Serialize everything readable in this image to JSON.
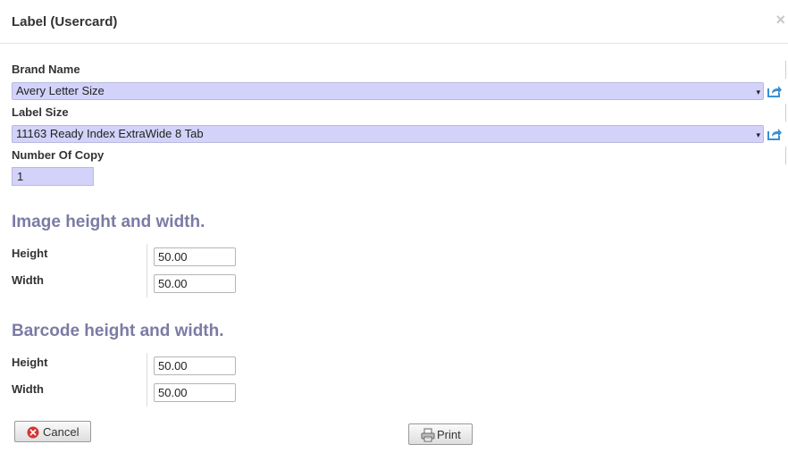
{
  "dialog": {
    "title": "Label (Usercard)",
    "close_symbol": "×"
  },
  "form": {
    "brand": {
      "label": "Brand Name",
      "value": "Avery Letter Size"
    },
    "size": {
      "label": "Label Size",
      "value": "11163 Ready Index ExtraWide 8 Tab"
    },
    "copies": {
      "label": "Number Of Copy",
      "value": "1"
    },
    "dropdown_arrow": "▾"
  },
  "image_section": {
    "heading": "Image height and width.",
    "height_label": "Height",
    "height_value": "50.00",
    "width_label": "Width",
    "width_value": "50.00"
  },
  "barcode_section": {
    "heading": "Barcode height and width.",
    "height_label": "Height",
    "height_value": "50.00",
    "width_label": "Width",
    "width_value": "50.00"
  },
  "buttons": {
    "cancel": "Cancel",
    "print": "Print"
  },
  "icons": {
    "external": "external-link-icon",
    "cancel": "cancel-circle-icon",
    "print": "printer-icon"
  },
  "colors": {
    "select_bg": "#d2d2fa",
    "section_heading": "#7b7ba6",
    "external_icon": "#3d8fd1",
    "cancel_icon": "#d93232"
  }
}
